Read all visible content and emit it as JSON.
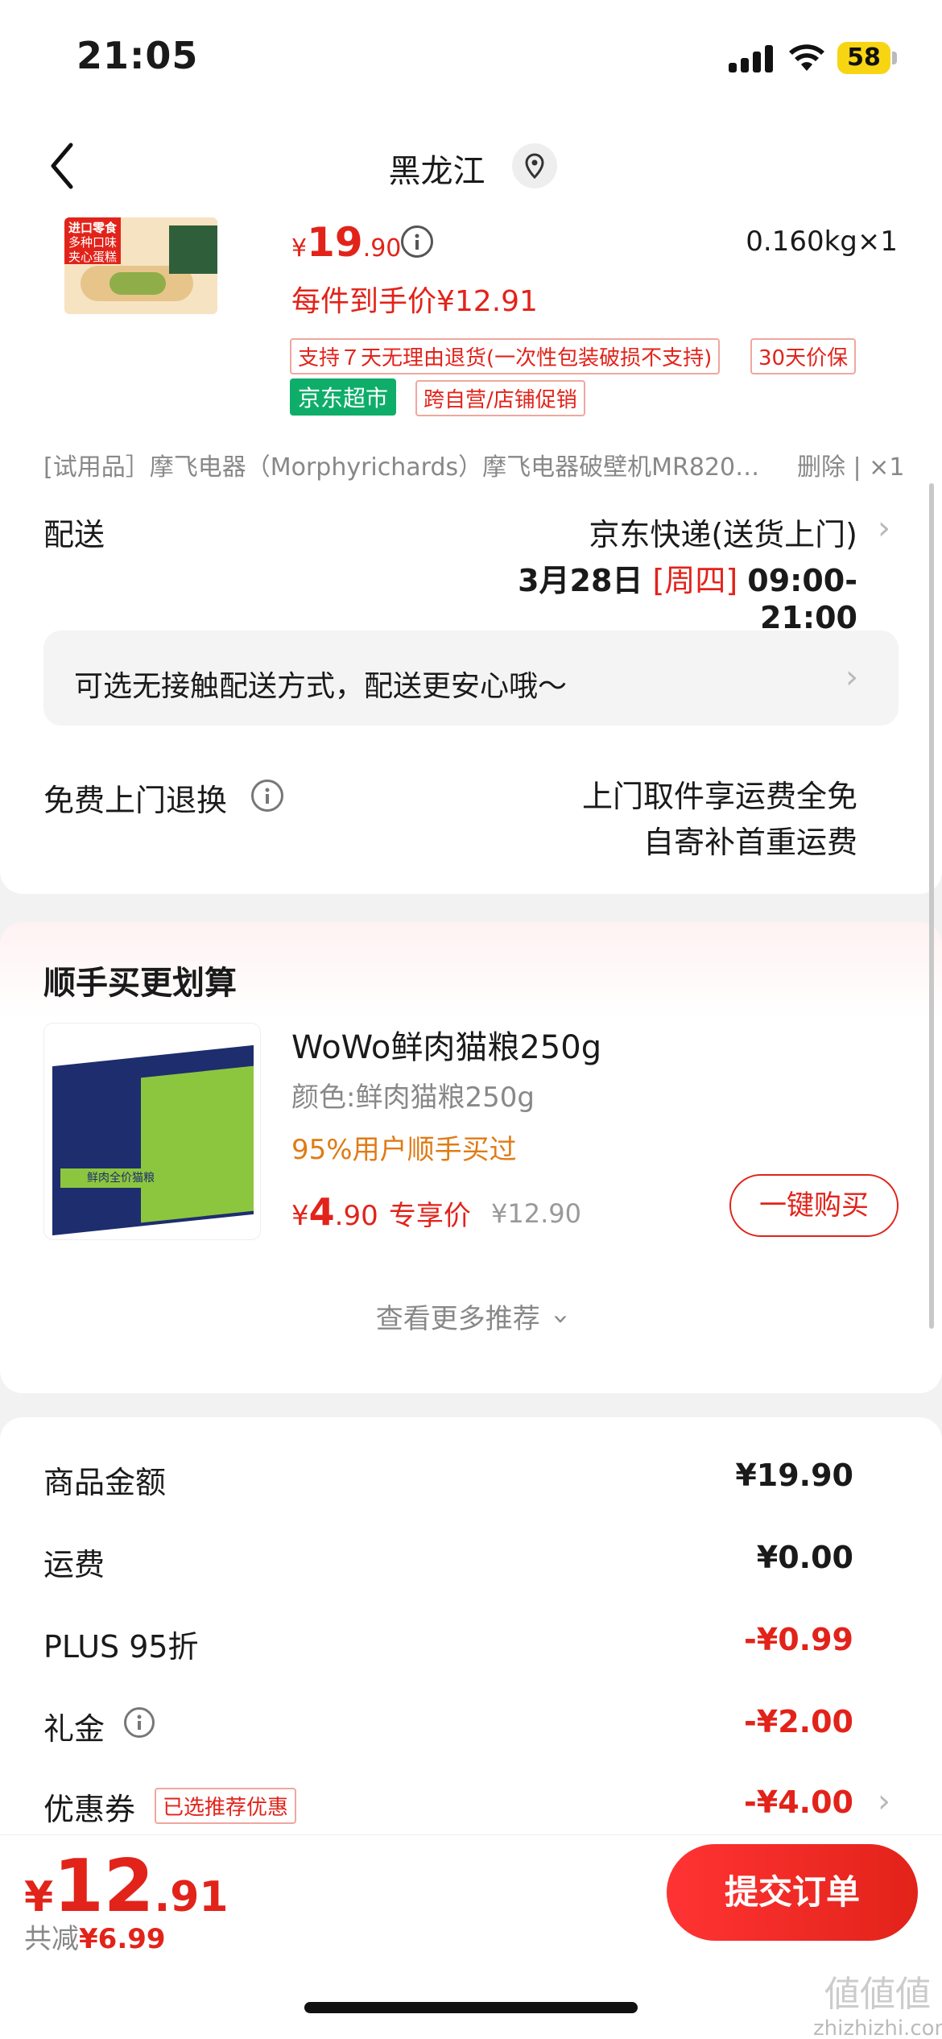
{
  "status": {
    "time": "21:05",
    "battery": "58"
  },
  "nav": {
    "title": "黑龙江"
  },
  "product": {
    "price_yen": "¥",
    "price_int": "19",
    "price_dec": ".90",
    "weight_qty": "0.160kg×1",
    "unit_price": "每件到手价¥12.91",
    "image_text": [
      "进口零食",
      "多种口味",
      "夹心蛋糕"
    ],
    "tags": {
      "return": "支持７天无理由退货(一次性包装破损不支持)",
      "price_protect": "30天价保",
      "store": "京东超市",
      "promo": "跨自营/店铺促销"
    },
    "trial_item": "[试用品］摩飞电器（Morphyrichards）摩飞电器破壁机MR8201...",
    "trial_ops": "删除 | ×1"
  },
  "delivery": {
    "label": "配送",
    "method": "京东快递(送货上门)",
    "date": "3月28日",
    "weekday": "[周四]",
    "time": "09:00-21:00",
    "contactless": "可选无接触配送方式，配送更安心哦～"
  },
  "returns": {
    "label": "免费上门退换",
    "line1": "上门取件享运费全免",
    "line2": "自寄补首重运费"
  },
  "recommend": {
    "title": "顺手买更划算",
    "name": "WoWo鲜肉猫粮250g",
    "color": "颜色:鲜肉猫粮250g",
    "bought": "95%用户顺手买过",
    "price_yen": "¥",
    "price_int": "4",
    "price_dec": ".90",
    "price_label": "专享价",
    "orig_price": "¥12.90",
    "buy_button": "一键购买",
    "more": "查看更多推荐",
    "image_text": "鲜肉全价猫粮"
  },
  "summary": {
    "rows": [
      {
        "label": "商品金额",
        "value": "¥19.90"
      },
      {
        "label": "运费",
        "value": "¥0.00"
      },
      {
        "label": "PLUS 95折",
        "value": "-¥0.99"
      },
      {
        "label": "礼金",
        "value": "-¥2.00"
      },
      {
        "label": "优惠券",
        "value": "-¥4.00",
        "tag": "已选推荐优惠"
      }
    ]
  },
  "footer": {
    "total_yen": "¥",
    "total_int": "12",
    "total_dec": ".91",
    "saved_label": "共减",
    "saved_value": "¥6.99",
    "submit": "提交订单",
    "watermark_1": "値値値",
    "watermark_2": "zhizhizhi.com"
  },
  "colors": {
    "accent": "#e2231a",
    "jd_green": "#0eae6a",
    "orange": "#e07b16"
  }
}
